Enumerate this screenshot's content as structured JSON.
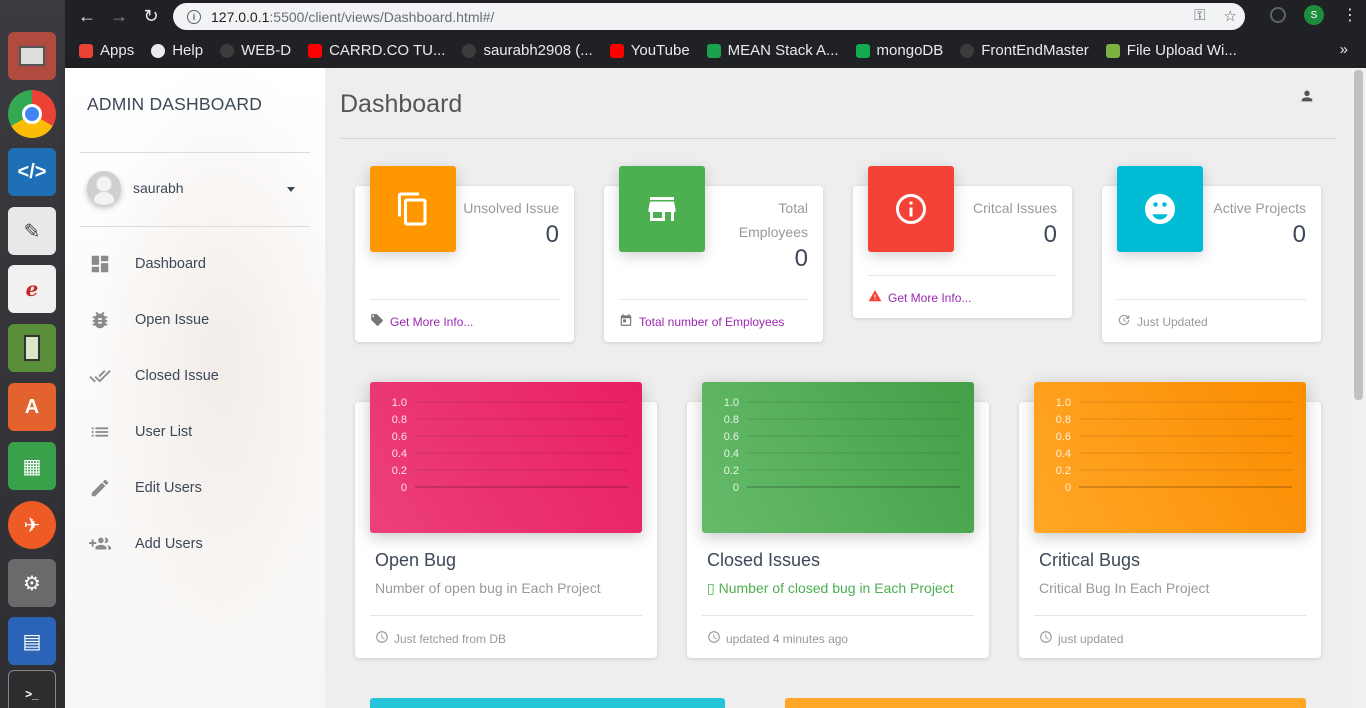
{
  "browser": {
    "url_host": "127.0.0.1",
    "url_path": ":5500/client/views/Dashboard.html#/",
    "profile_initial": "S",
    "bookmarks": [
      {
        "label": "Apps",
        "icon": "apps-grid-icon",
        "color": "#ea4335"
      },
      {
        "label": "Help",
        "icon": "globe-icon",
        "color": "#e8eaed"
      },
      {
        "label": "WEB-D",
        "icon": "github-icon",
        "color": "#3c3c3c"
      },
      {
        "label": "CARRD.CO TU...",
        "icon": "youtube-icon",
        "color": "#ff0000"
      },
      {
        "label": "saurabh2908 (...",
        "icon": "github-icon",
        "color": "#3c3c3c"
      },
      {
        "label": "YouTube",
        "icon": "youtube-icon",
        "color": "#ff0000"
      },
      {
        "label": "MEAN Stack A...",
        "icon": "mean-icon",
        "color": "#1aa34a"
      },
      {
        "label": "mongoDB",
        "icon": "mongodb-leaf-icon",
        "color": "#13aa52"
      },
      {
        "label": "FrontEndMaster",
        "icon": "github-icon",
        "color": "#3c3c3c"
      },
      {
        "label": "File Upload Wi...",
        "icon": "leaf-icon",
        "color": "#7cb342"
      }
    ],
    "more": "»"
  },
  "sidebar": {
    "brand": "ADMIN DASHBOARD",
    "user_name": "saurabh",
    "items": [
      {
        "label": "Dashboard",
        "icon": "dashboard-icon"
      },
      {
        "label": "Open Issue",
        "icon": "bug-icon"
      },
      {
        "label": "Closed Issue",
        "icon": "done-all-icon"
      },
      {
        "label": "User List",
        "icon": "list-icon"
      },
      {
        "label": "Edit Users",
        "icon": "edit-pencil-icon"
      },
      {
        "label": "Add Users",
        "icon": "group-add-icon"
      }
    ]
  },
  "main": {
    "title": "Dashboard",
    "stats": [
      {
        "category": "Unsolved Issue",
        "value": "0",
        "footer": "Get More Info...",
        "footer_icon": "tag-icon",
        "color": "#ff9800",
        "icon": "copy-icon",
        "footer_color": "#9c27b0"
      },
      {
        "category": "Total Employees",
        "value": "0",
        "footer": "Total number of Employees",
        "footer_icon": "calendar-icon",
        "color": "#4caf50",
        "icon": "store-icon",
        "footer_color": "#9c27b0"
      },
      {
        "category": "Critcal Issues",
        "value": "0",
        "footer": "Get More Info...",
        "footer_icon": "warning-icon",
        "color": "#f44336",
        "icon": "info-icon",
        "footer_color": "#9c27b0"
      },
      {
        "category": "Active Projects",
        "value": "0",
        "footer": "Just Updated",
        "footer_icon": "update-icon",
        "color": "#00bcd4",
        "icon": "face-icon",
        "footer_color": "#999999"
      }
    ],
    "charts": [
      {
        "title": "Open Bug",
        "subtitle": "Number of open bug in Each Project",
        "footer": "Just fetched from DB",
        "color_from": "#ec407a",
        "color_to": "#e91e63",
        "subtitle_color": "#999999",
        "subtitle_prefix": ""
      },
      {
        "title": "Closed Issues",
        "subtitle": "Number of closed bug in Each Project",
        "footer": "updated 4 minutes ago",
        "color_from": "#66bb6a",
        "color_to": "#43a047",
        "subtitle_color": "#4caf50",
        "subtitle_prefix": "▯ "
      },
      {
        "title": "Critical Bugs",
        "subtitle": "Critical Bug In Each Project",
        "footer": "just updated",
        "color_from": "#ffa726",
        "color_to": "#fb8c00",
        "subtitle_color": "#999999",
        "subtitle_prefix": ""
      }
    ]
  },
  "chart_data": [
    {
      "type": "line",
      "title": "Open Bug",
      "x": [],
      "series": [],
      "ylim": [
        0,
        1.0
      ],
      "yticks": [
        "1.0",
        "0.8",
        "0.6",
        "0.4",
        "0.2",
        "0"
      ],
      "grid": true
    },
    {
      "type": "line",
      "title": "Closed Issues",
      "x": [],
      "series": [],
      "ylim": [
        0,
        1.0
      ],
      "yticks": [
        "1.0",
        "0.8",
        "0.6",
        "0.4",
        "0.2",
        "0"
      ],
      "grid": true
    },
    {
      "type": "line",
      "title": "Critical Bugs",
      "x": [],
      "series": [],
      "ylim": [
        0,
        1.0
      ],
      "yticks": [
        "1.0",
        "0.8",
        "0.6",
        "0.4",
        "0.2",
        "0"
      ],
      "grid": true
    }
  ]
}
